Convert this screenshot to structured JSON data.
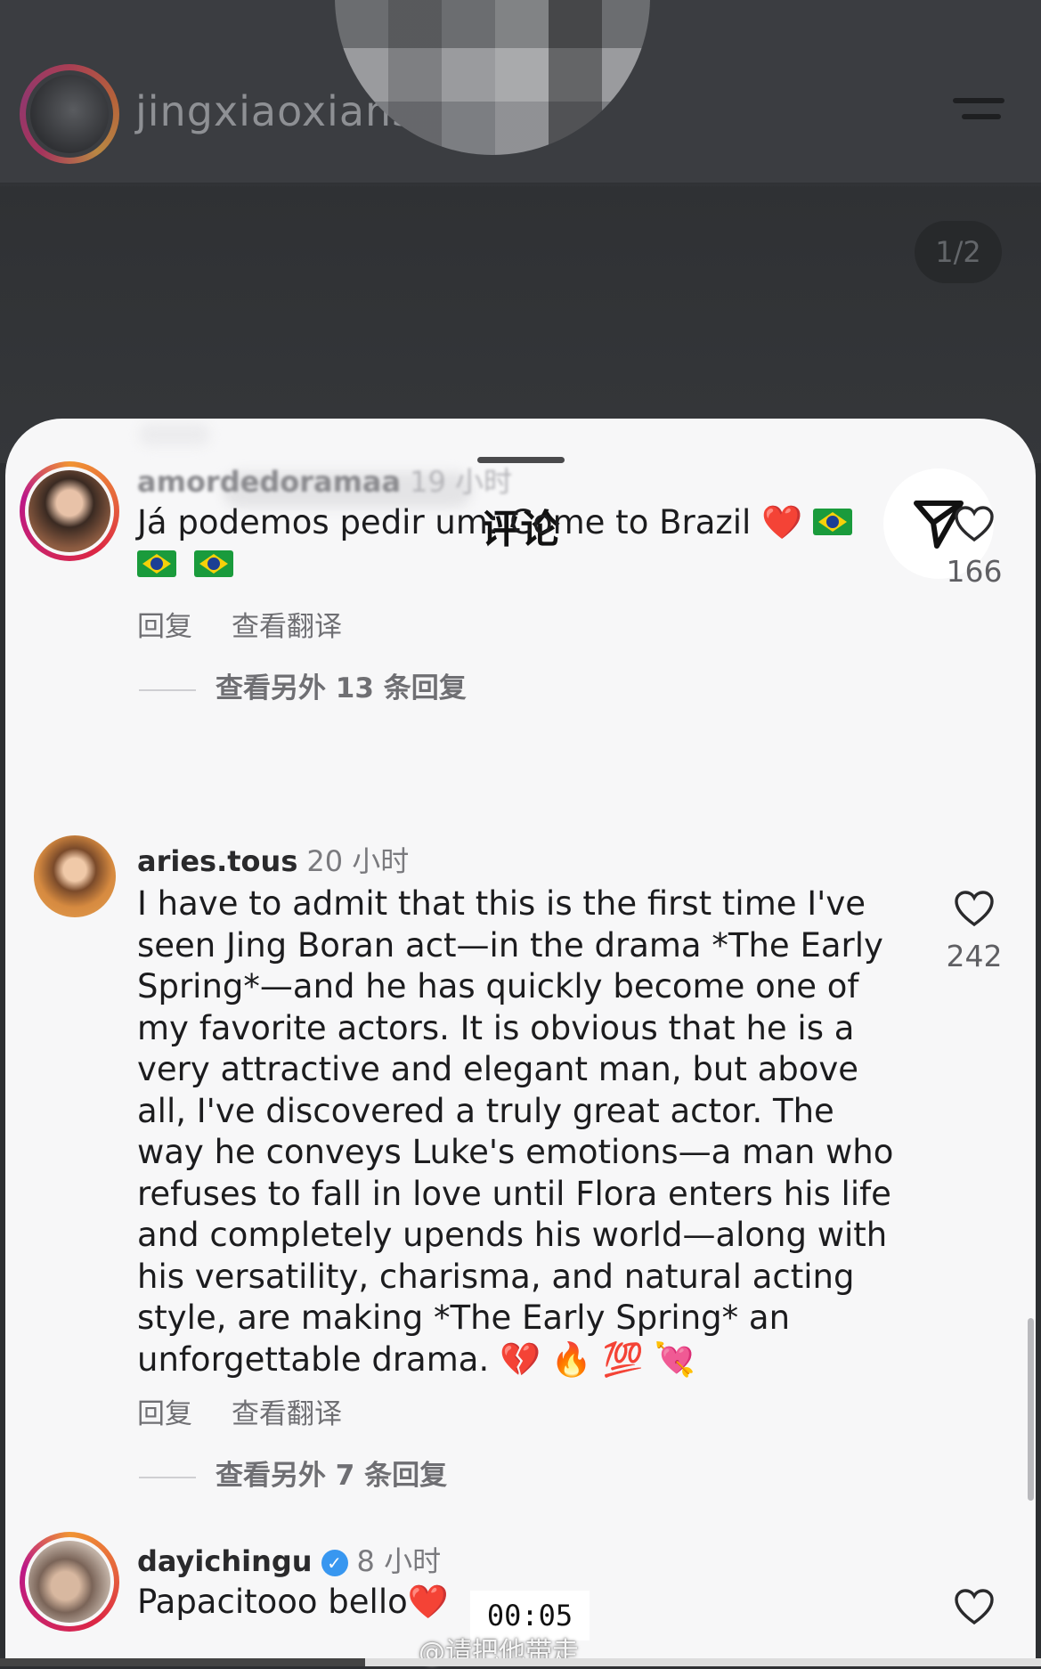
{
  "post": {
    "username": "jingxiaoxiansh",
    "page_counter": "1/2"
  },
  "sheet": {
    "title": "评论"
  },
  "comments": [
    {
      "username": "amordedoramaa",
      "time": "19 小时",
      "text": "Já podemos pedir um: Come to Brazil",
      "emoji": "❤️",
      "likes": "166",
      "reply": "回复",
      "translate": "查看翻译",
      "more_replies": "查看另外 13 条回复"
    },
    {
      "username": "aries.tous",
      "time": "20 小时",
      "text_lines": [
        "I have to admit that this is the first time I've",
        "seen Jing Boran act—in the drama *The Early",
        "Spring*—and he has quickly become one of",
        "my favorite actors. It is obvious that he is a",
        "very attractive and elegant man, but above",
        "all, I've discovered a truly great actor. The",
        "way he conveys Luke's emotions—a man who",
        "refuses to fall in love until Flora enters his life",
        "and completely upends his world—along with",
        "his versatility, charisma, and natural acting",
        "style, are making *The Early Spring* an",
        "unforgettable drama. 💔 🔥 💯 💘"
      ],
      "likes": "242",
      "reply": "回复",
      "translate": "查看翻译",
      "more_replies": "查看另外 7 条回复"
    },
    {
      "username": "dayichingu",
      "verified": true,
      "time": "8 小时",
      "text": "Papacitooo bello",
      "emoji": "❤️"
    }
  ],
  "overlay": {
    "timestamp": "00:05",
    "watermark": "@请把他带走"
  },
  "icons": {
    "like": "heart-outline-icon",
    "share": "paper-plane-icon",
    "menu": "hamburger-menu-icon",
    "verified": "verified-badge-icon"
  },
  "colors": {
    "sheet_bg": "#f7f7f8",
    "verified": "#3897f0",
    "story_ring": "#e1306c",
    "heart": "#e0251b"
  }
}
